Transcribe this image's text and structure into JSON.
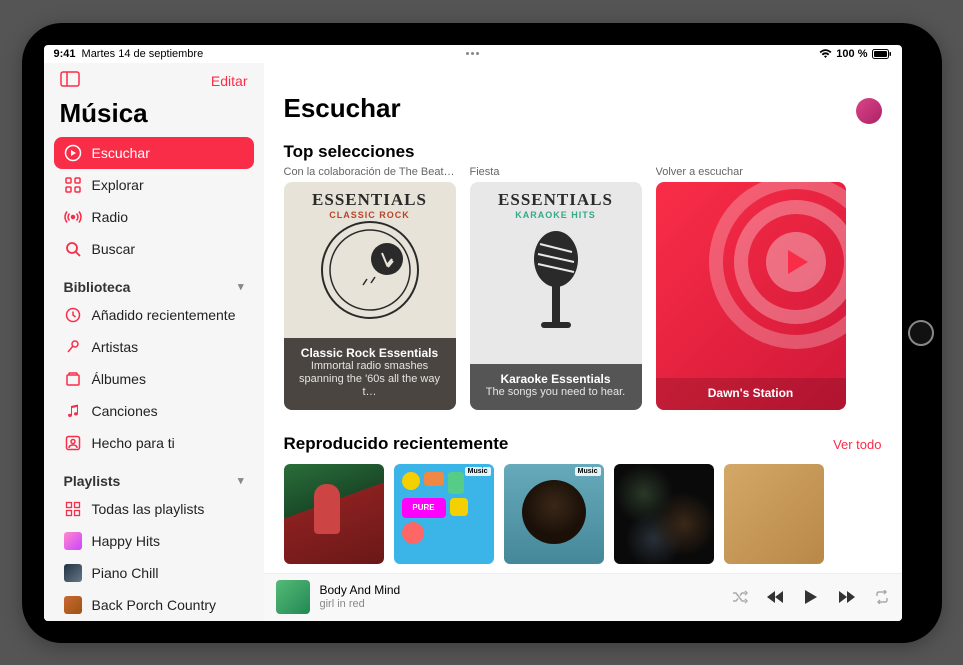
{
  "status": {
    "time": "9:41",
    "date": "Martes 14 de septiembre",
    "battery": "100 %"
  },
  "sidebar": {
    "edit": "Editar",
    "title": "Música",
    "nav": [
      {
        "label": "Escuchar"
      },
      {
        "label": "Explorar"
      },
      {
        "label": "Radio"
      },
      {
        "label": "Buscar"
      }
    ],
    "library_header": "Biblioteca",
    "library": [
      {
        "label": "Añadido recientemente"
      },
      {
        "label": "Artistas"
      },
      {
        "label": "Álbumes"
      },
      {
        "label": "Canciones"
      },
      {
        "label": "Hecho para ti"
      }
    ],
    "playlists_header": "Playlists",
    "playlists": [
      {
        "label": "Todas las playlists"
      },
      {
        "label": "Happy Hits"
      },
      {
        "label": "Piano Chill"
      },
      {
        "label": "Back Porch Country"
      }
    ]
  },
  "main": {
    "title": "Escuchar",
    "top_picks_title": "Top selecciones",
    "top_picks": [
      {
        "subtitle": "Con la colaboración de The Beatles",
        "art_title": "ESSENTIALS",
        "art_sub": "CLASSIC ROCK",
        "caption_title": "Classic Rock Essentials",
        "caption_sub": "Immortal radio smashes spanning the '60s all the way t…"
      },
      {
        "subtitle": "Fiesta",
        "art_title": "ESSENTIALS",
        "art_sub": "KARAOKE HITS",
        "caption_title": "Karaoke Essentials",
        "caption_sub": "The songs you need to hear."
      },
      {
        "subtitle": "Volver a escuchar",
        "caption_title": "Dawn's Station"
      }
    ],
    "recent_title": "Reproducido recientemente",
    "see_all": "Ver todo",
    "music_badge": "Music"
  },
  "player": {
    "title": "Body And Mind",
    "artist": "girl in red"
  }
}
